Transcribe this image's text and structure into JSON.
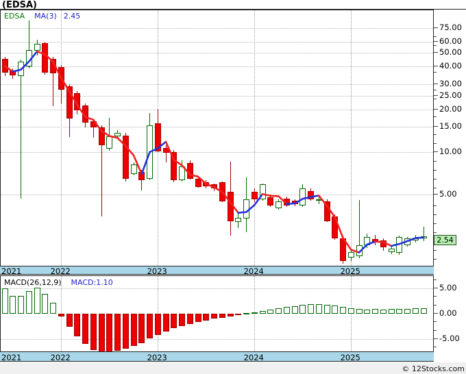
{
  "title": "(EDSA)",
  "watermark": "© 12Stocks.com",
  "price_panel": {
    "legend": {
      "symbol": "EDSA",
      "ma_label": "MA(3)",
      "ma_value": "2.45"
    },
    "last_price_label": "2.54",
    "y_tick_labels": [
      "75.00",
      "60.00",
      "50.00",
      "40.00",
      "30.00",
      "25.00",
      "20.00",
      "15.00",
      "10.00",
      "5.00"
    ]
  },
  "macd_panel": {
    "legend_label": "MACD(26,12,9)",
    "legend_value": "MACD:1.10",
    "y_tick_labels": [
      "5.00",
      "0.00",
      "-5.00"
    ]
  },
  "chart_data": {
    "type": "candlestick_with_macd_bar",
    "symbol": "EDSA",
    "interval": "monthly",
    "x_start": "2021-06",
    "price_scale": "log",
    "x_years": [
      "2021",
      "2022",
      "2023",
      "2024",
      "2025"
    ],
    "year_start_indices": [
      -7,
      7,
      19,
      31,
      43
    ],
    "y_ticks": [
      75,
      60,
      50,
      40,
      30,
      25,
      20,
      15,
      10,
      5
    ],
    "last_close": 2.54,
    "ma_window": 3,
    "ma_seed": [
      45,
      40
    ],
    "candles_ohlc": [
      [
        45.4,
        47,
        34.5,
        36.4
      ],
      [
        37.5,
        39,
        33,
        34.6
      ],
      [
        34.4,
        45,
        4.7,
        43.5
      ],
      [
        40.3,
        85,
        39,
        52.6
      ],
      [
        51.7,
        62,
        48,
        57.8
      ],
      [
        58.6,
        60,
        35,
        36.4
      ],
      [
        45.5,
        47,
        21,
        35.9
      ],
      [
        39.9,
        41,
        22,
        27.6
      ],
      [
        29.1,
        30,
        12.7,
        17.3
      ],
      [
        26,
        27,
        18.5,
        19.6
      ],
      [
        21.3,
        22,
        14.9,
        16.1
      ],
      [
        16.4,
        17,
        12.6,
        14.9
      ],
      [
        14.9,
        15.5,
        3.5,
        11.1
      ],
      [
        10.5,
        17.4,
        10.2,
        12.9
      ],
      [
        12.9,
        14.2,
        12.3,
        13.7
      ],
      [
        13.1,
        13.6,
        6.2,
        6.45
      ],
      [
        7.0,
        8.4,
        6.8,
        8.2
      ],
      [
        7.24,
        7.5,
        5.37,
        6.33
      ],
      [
        6.45,
        18.9,
        6.3,
        15.4
      ],
      [
        15.9,
        20,
        10,
        10.1
      ],
      [
        10.7,
        11.2,
        8.4,
        9.9
      ],
      [
        9.94,
        10.3,
        6.1,
        6.33
      ],
      [
        6.33,
        8.7,
        6.2,
        7.92
      ],
      [
        8.36,
        8.7,
        6.4,
        6.48
      ],
      [
        6.48,
        6.7,
        5.6,
        5.68
      ],
      [
        6.1,
        6.3,
        5.5,
        5.7
      ],
      [
        5.9,
        6.0,
        5.3,
        5.5
      ],
      [
        6.1,
        6.2,
        4.4,
        4.45
      ],
      [
        5.2,
        8.5,
        2.56,
        3.25
      ],
      [
        3.19,
        3.7,
        2.9,
        3.44
      ],
      [
        3.38,
        6.6,
        2.7,
        4.6
      ],
      [
        5.2,
        5.5,
        4.4,
        4.6
      ],
      [
        4.6,
        6.0,
        4.5,
        5.9
      ],
      [
        4.78,
        5.0,
        4.1,
        4.2
      ],
      [
        4.0,
        4.6,
        3.9,
        4.47
      ],
      [
        4.7,
        4.85,
        4.1,
        4.2
      ],
      [
        4.5,
        4.65,
        4.15,
        4.3
      ],
      [
        4.2,
        5.9,
        4.1,
        5.5
      ],
      [
        5.3,
        5.55,
        4.5,
        4.6
      ],
      [
        4.5,
        4.95,
        4.3,
        4.65
      ],
      [
        4.47,
        4.6,
        3.2,
        3.25
      ],
      [
        3.5,
        3.6,
        2.4,
        2.45
      ],
      [
        2.45,
        2.5,
        1.62,
        1.7
      ],
      [
        1.79,
        2.0,
        1.7,
        1.96
      ],
      [
        1.83,
        4.55,
        1.78,
        2.19
      ],
      [
        2.19,
        2.65,
        2.1,
        2.5
      ],
      [
        2.42,
        2.6,
        2.2,
        2.29
      ],
      [
        2.37,
        2.45,
        2.0,
        2.13
      ],
      [
        1.96,
        2.15,
        1.9,
        2.08
      ],
      [
        1.94,
        2.55,
        1.88,
        2.5
      ],
      [
        2.19,
        2.5,
        2.15,
        2.45
      ],
      [
        2.37,
        2.6,
        2.3,
        2.45
      ],
      [
        2.45,
        2.95,
        2.35,
        2.54
      ]
    ],
    "macd": {
      "params": [
        26,
        12,
        9
      ],
      "y_ticks": [
        5,
        0,
        -5
      ],
      "last_value": 1.1,
      "values": [
        5.0,
        3.5,
        3.5,
        4.4,
        5.2,
        3.9,
        2.2,
        -0.6,
        -2.6,
        -4.4,
        -6.0,
        -7.1,
        -7.6,
        -7.6,
        -7.3,
        -6.9,
        -6.4,
        -5.8,
        -4.9,
        -4.2,
        -3.5,
        -2.9,
        -2.4,
        -2.0,
        -1.6,
        -1.3,
        -1.0,
        -0.75,
        -0.5,
        -0.3,
        0.15,
        0.3,
        0.55,
        0.8,
        1.05,
        1.3,
        1.55,
        1.75,
        1.85,
        1.9,
        1.8,
        1.6,
        1.35,
        1.1,
        0.95,
        0.85,
        0.9,
        0.85,
        0.9,
        0.95,
        1.0,
        1.05,
        1.1
      ]
    },
    "colors": {
      "up": "#006600",
      "down_fill": "#ee0000",
      "down_edge": "#aa0000",
      "down_wick": "#990000",
      "ma_up": "#2233dd",
      "ma_down": "#ee2222",
      "axis_band": "#a9d7e9",
      "badge_bg": "#b5f0b0"
    }
  }
}
